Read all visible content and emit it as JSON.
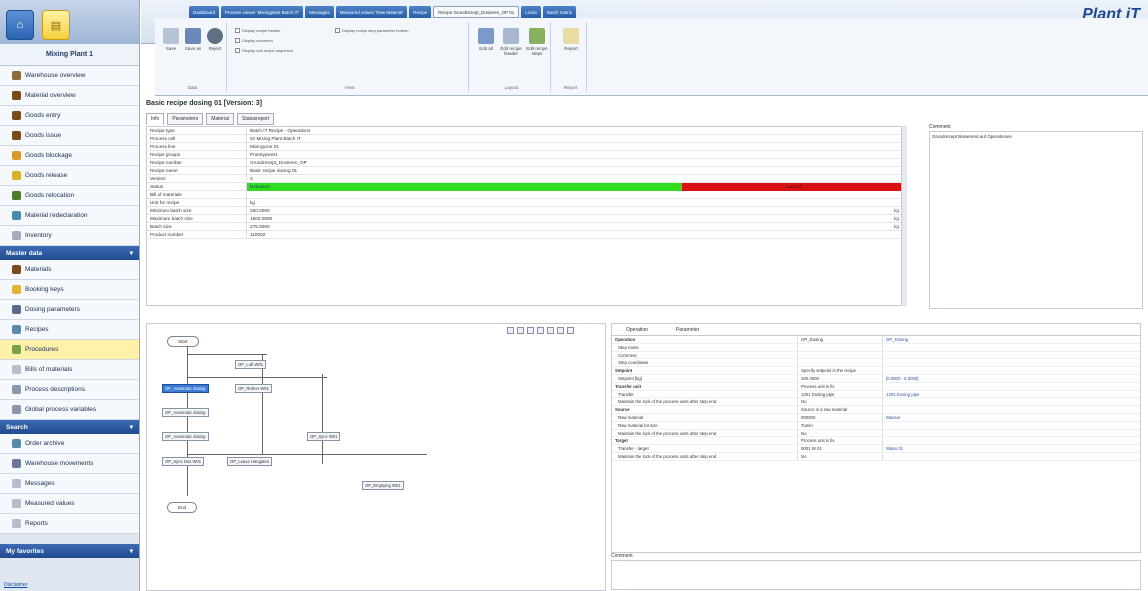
{
  "app": {
    "logo": "Plant iT",
    "plant": "Mixing Plant 1",
    "favorites": "My favorites",
    "disclaimer": "Disclaimer"
  },
  "sidebar": {
    "group1": [
      {
        "label": "Warehouse overview",
        "icon": "warehouse-icon",
        "color": "#8a6a3a"
      },
      {
        "label": "Material overview",
        "icon": "material-icon",
        "color": "#7a4a1a"
      },
      {
        "label": "Goods entry",
        "icon": "goods-entry-icon",
        "color": "#7a4a1a"
      },
      {
        "label": "Goods issue",
        "icon": "goods-issue-icon",
        "color": "#7a4a1a"
      },
      {
        "label": "Goods blockage",
        "icon": "goods-blockage-icon",
        "color": "#d89b2b"
      },
      {
        "label": "Goods release",
        "icon": "goods-release-icon",
        "color": "#d8b32b"
      },
      {
        "label": "Goods relocation",
        "icon": "goods-relocation-icon",
        "color": "#4a7a2a"
      },
      {
        "label": "Material redeclaration",
        "icon": "redeclaration-icon",
        "color": "#4a8aaa"
      },
      {
        "label": "Inventory",
        "icon": "inventory-icon",
        "color": "#aab"
      }
    ],
    "master_head": "Master data",
    "master": [
      {
        "label": "Materials",
        "icon": "materials-icon",
        "color": "#7a4a1a"
      },
      {
        "label": "Booking keys",
        "icon": "key-icon",
        "color": "#e2b33a"
      },
      {
        "label": "Dosing parameters",
        "icon": "dosing-icon",
        "color": "#5a6a8a"
      },
      {
        "label": "Recipes",
        "icon": "recipes-icon",
        "color": "#5a8aaa"
      },
      {
        "label": "Procedures",
        "icon": "procedures-icon",
        "color": "#7aa04a"
      },
      {
        "label": "Bills of materials",
        "icon": "bom-icon",
        "color": "#bbc"
      },
      {
        "label": "Process descriptions",
        "icon": "process-icon",
        "color": "#8898aa"
      },
      {
        "label": "Global process variables",
        "icon": "variables-icon",
        "color": "#8898aa"
      }
    ],
    "search_head": "Search",
    "search": [
      {
        "label": "Order archive",
        "icon": "archive-icon",
        "color": "#5a8aaa"
      },
      {
        "label": "Warehouse movements",
        "icon": "movements-icon",
        "color": "#6a7a9a"
      },
      {
        "label": "Messages",
        "icon": "messages-icon",
        "color": "#bbc"
      },
      {
        "label": "Measured values",
        "icon": "measured-icon",
        "color": "#bbc"
      },
      {
        "label": "Reports",
        "icon": "reports-icon",
        "color": "#bbc"
      }
    ]
  },
  "tabs": [
    "Dashboard",
    "Process viewer 'Mixingplant Batch IT'",
    "Messages",
    "Measured values 'Raw Material'",
    "Recipe",
    "Recipe Grundrezept_Dosieren_OP 01",
    "Locks",
    "Batch matrix"
  ],
  "ribbon": {
    "save": "Save",
    "save_as": "Save as",
    "reject": "Reject",
    "data_group": "Data",
    "checks": [
      "Display recipe header",
      "Display comment",
      "Display unit recipe sequence",
      "Display recipe step parameter bottom"
    ],
    "view_group": "View",
    "edit_all": "Edit all",
    "edit_header": "Edit recipe header",
    "edit_steps": "Edit recipe steps",
    "layout_group": "Layout",
    "report": "Report",
    "report_group": "Report"
  },
  "recipe": {
    "title": "Basic recipe dosing 01 [Version: 3]",
    "subtabs": [
      "Info",
      "Parameters",
      "Material",
      "Statusreport"
    ],
    "rows": [
      {
        "k": "Recipe type",
        "v": "Batch IT Recipe - Operations"
      },
      {
        "k": "Process cell",
        "v": "01 Mixing Plant Batch IT"
      },
      {
        "k": "Process line",
        "v": "MixingLine 01"
      },
      {
        "k": "Recipe groups",
        "v": "Prototypes01"
      },
      {
        "k": "Recipe number",
        "v": "Grundrezept_Dosieren_OP"
      },
      {
        "k": "Recipe name",
        "v": "Basic recipe dosing 01"
      },
      {
        "k": "Version",
        "v": "3"
      }
    ],
    "status_label": "Status",
    "status_released": "Released",
    "status_locked": "Locked",
    "rows2": [
      {
        "k": "Bill of materials",
        "v": "",
        "u": ""
      },
      {
        "k": "Unit for recipe",
        "v": "kg",
        "u": ""
      },
      {
        "k": "Minimum batch size",
        "v": "250.0000",
        "u": "kg"
      },
      {
        "k": "Maximum batch size",
        "v": "1500.0000",
        "u": "kg"
      },
      {
        "k": "Batch size",
        "v": "275.0000",
        "u": "kg"
      },
      {
        "k": "Product number",
        "v": "110002",
        "u": ""
      }
    ],
    "comment_label": "Comment",
    "comment": "Grundrezept Basierend auf Operationen"
  },
  "diagram": {
    "start": "Start",
    "end": "End",
    "nodes": [
      "OP_Luft W01",
      "OP_Automatic dosing",
      "OP_Rührer W01",
      "OP_Automatic dosing",
      "OP_Automatic dosing",
      "OP_Sync W01",
      "OP_Sync Dos W01",
      "OP_Leave Hangaten",
      "OP_Emptying W01"
    ]
  },
  "op": {
    "tab1": "Operation",
    "tab2": "Parameter",
    "rows": [
      {
        "a": "Operation",
        "b": "OP_Dosing",
        "c": "OP_Dosing",
        "g": true
      },
      {
        "a": "Step name",
        "b": "",
        "c": ""
      },
      {
        "a": "Comment",
        "b": "",
        "c": ""
      },
      {
        "a": "Step coordinate",
        "b": "",
        "c": ""
      },
      {
        "a": "Setpoint",
        "b": "Specify setpoint in the recipe",
        "c": "",
        "g": true
      },
      {
        "a": "Setpoint [kg]",
        "b": "100.0000",
        "c": "[0.0000 - 5.0000]"
      },
      {
        "a": "Transfer unit",
        "b": "Process unit is fix",
        "c": "",
        "g": true
      },
      {
        "a": "Transfer",
        "b": "1301 Dosing pipe",
        "c": "1301 Dosing pipe"
      },
      {
        "a": "Maintain the lock of the process units after step end",
        "b": "No",
        "c": ""
      },
      {
        "a": "Source",
        "b": "Source is a raw material",
        "c": "",
        "g": true
      },
      {
        "a": "Raw material",
        "b": "000000",
        "c": "Wasser"
      },
      {
        "a": "Raw material lot size",
        "b": "Tumin",
        "c": ""
      },
      {
        "a": "Maintain the lock of the process units after step end",
        "b": "No",
        "c": ""
      },
      {
        "a": "Target",
        "b": "Process unit is fix",
        "c": "",
        "g": true
      },
      {
        "a": "Transfer - target",
        "b": "0001 W 01",
        "c": "Waan 01"
      },
      {
        "a": "Maintain the lock of the process units after step end",
        "b": "No",
        "c": ""
      }
    ],
    "comment_label": "Comment"
  }
}
